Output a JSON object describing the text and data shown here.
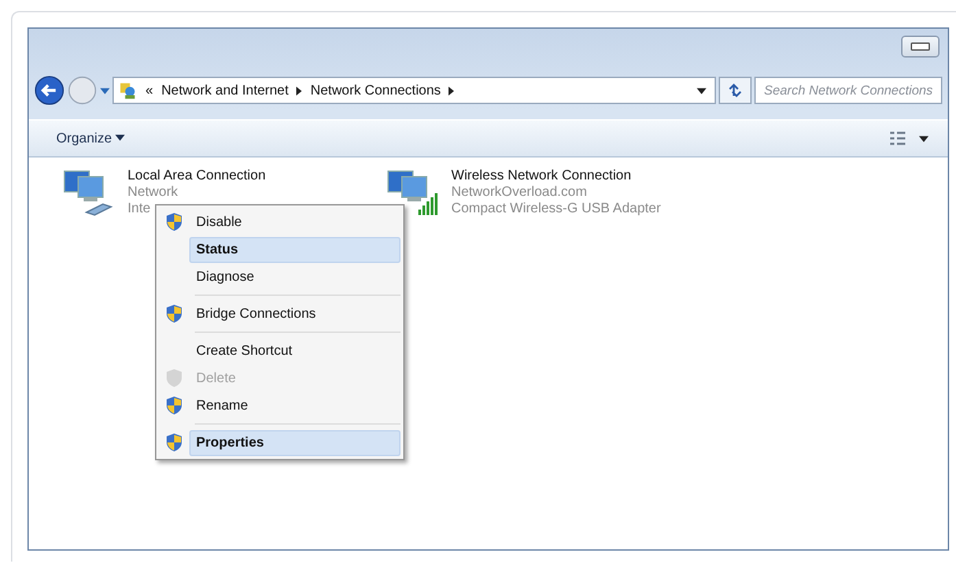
{
  "address_bar": {
    "overflow": "«",
    "crumbs": [
      "Network and Internet",
      "Network Connections"
    ],
    "search": {
      "placeholder": "Search Network Connections"
    }
  },
  "toolbar": {
    "organize": "Organize"
  },
  "connections": [
    {
      "kind": "wired",
      "name": "Local Area Connection",
      "lines": [
        "Network",
        "Inte"
      ]
    },
    {
      "kind": "wireless",
      "name": "Wireless Network Connection",
      "lines": [
        "NetworkOverload.com",
        "Compact Wireless-G USB Adapter"
      ]
    }
  ],
  "context_menu": [
    {
      "label": "Disable",
      "shield": true,
      "selected": false,
      "disabled": false,
      "separator_before": false
    },
    {
      "label": "Status",
      "shield": false,
      "selected": true,
      "disabled": false,
      "separator_before": false
    },
    {
      "label": "Diagnose",
      "shield": false,
      "selected": false,
      "disabled": false,
      "separator_before": false
    },
    {
      "label": "Bridge Connections",
      "shield": true,
      "selected": false,
      "disabled": false,
      "separator_before": true
    },
    {
      "label": "Create Shortcut",
      "shield": false,
      "selected": false,
      "disabled": false,
      "separator_before": true
    },
    {
      "label": "Delete",
      "shield": true,
      "selected": false,
      "disabled": true,
      "separator_before": false
    },
    {
      "label": "Rename",
      "shield": true,
      "selected": false,
      "disabled": false,
      "separator_before": false
    },
    {
      "label": "Properties",
      "shield": true,
      "selected": true,
      "disabled": false,
      "separator_before": true
    }
  ]
}
